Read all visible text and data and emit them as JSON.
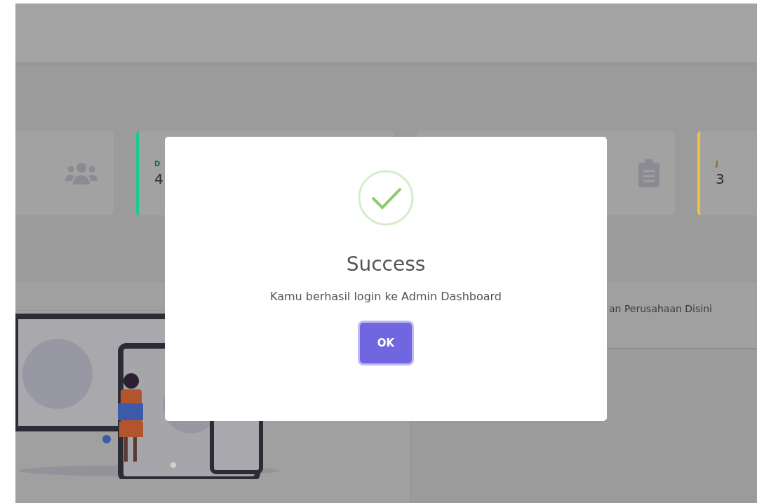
{
  "cards": [
    {
      "kind": "users"
    },
    {
      "kind": "stat",
      "label": "D",
      "value": "4",
      "color": "#1cc88a"
    },
    {
      "kind": "clipboard"
    },
    {
      "kind": "stat",
      "label": "J",
      "value": "3",
      "color": "#f6c23e"
    }
  ],
  "right_panel": {
    "title": "an Perusahaan Disini"
  },
  "dialog": {
    "title": "Success",
    "message": "Kamu berhasil login ke Admin Dashboard",
    "button": "OK"
  }
}
